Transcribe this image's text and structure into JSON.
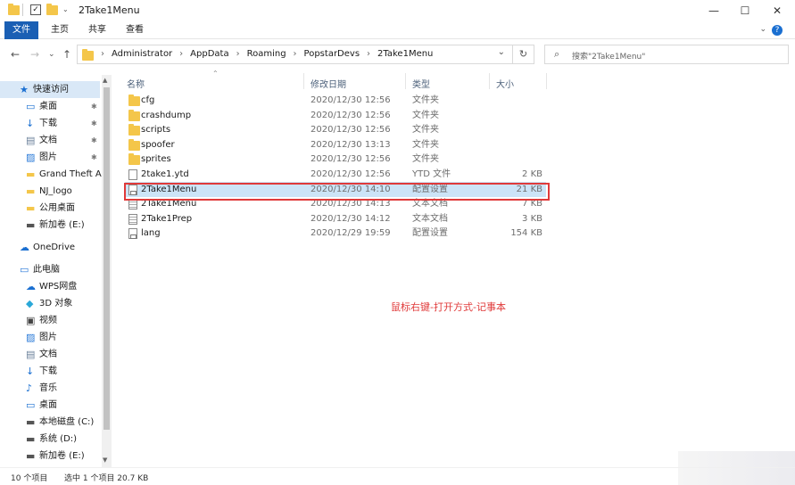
{
  "window": {
    "title": "2Take1Menu",
    "minimize": "—",
    "maximize": "☐",
    "close": "✕"
  },
  "ribbon": {
    "tabs": [
      "文件",
      "主页",
      "共享",
      "查看"
    ],
    "expand": "⌄",
    "help": "?"
  },
  "nav": {
    "back": "←",
    "forward": "→",
    "recent": "⌄",
    "up": "↑",
    "breadcrumb": [
      "Administrator",
      "AppData",
      "Roaming",
      "PopstarDevs",
      "2Take1Menu"
    ],
    "dropdown": "⌄",
    "refresh": "↻"
  },
  "search": {
    "icon": "search-icon",
    "placeholder": "搜索\"2Take1Menu\""
  },
  "sidebar": {
    "items": [
      {
        "label": "快速访问",
        "icon": "star-icon",
        "pin": false
      },
      {
        "label": "桌面",
        "icon": "desktop-icon",
        "pin": true
      },
      {
        "label": "下载",
        "icon": "download-icon",
        "pin": true
      },
      {
        "label": "文档",
        "icon": "document-icon",
        "pin": true
      },
      {
        "label": "图片",
        "icon": "picture-icon",
        "pin": true
      },
      {
        "label": "Grand Theft Au",
        "icon": "folder-icon",
        "pin": false
      },
      {
        "label": "NJ_logo",
        "icon": "folder-icon",
        "pin": false
      },
      {
        "label": "公用桌面",
        "icon": "folder-icon",
        "pin": false
      },
      {
        "label": "新加卷 (E:)",
        "icon": "drive-icon",
        "pin": false
      },
      {
        "label": "OneDrive",
        "icon": "cloud-icon",
        "pin": false
      },
      {
        "label": "此电脑",
        "icon": "computer-icon",
        "pin": false
      },
      {
        "label": "WPS网盘",
        "icon": "cloud-icon",
        "pin": false
      },
      {
        "label": "3D 对象",
        "icon": "cube-icon",
        "pin": false
      },
      {
        "label": "视频",
        "icon": "video-icon",
        "pin": false
      },
      {
        "label": "图片",
        "icon": "picture-icon",
        "pin": false
      },
      {
        "label": "文档",
        "icon": "document-icon",
        "pin": false
      },
      {
        "label": "下载",
        "icon": "download-icon",
        "pin": false
      },
      {
        "label": "音乐",
        "icon": "music-icon",
        "pin": false
      },
      {
        "label": "桌面",
        "icon": "desktop-icon",
        "pin": false
      },
      {
        "label": "本地磁盘 (C:)",
        "icon": "drive-icon",
        "pin": false
      },
      {
        "label": "系统 (D:)",
        "icon": "drive-icon",
        "pin": false
      },
      {
        "label": "新加卷 (E:)",
        "icon": "drive-icon",
        "pin": false
      }
    ],
    "pin_glyph": "📌"
  },
  "columns": {
    "name": "名称",
    "date": "修改日期",
    "type": "类型",
    "size": "大小"
  },
  "files": [
    {
      "name": "cfg",
      "date": "2020/12/30 12:56",
      "type": "文件夹",
      "size": "",
      "kind": "folder"
    },
    {
      "name": "crashdump",
      "date": "2020/12/30 12:56",
      "type": "文件夹",
      "size": "",
      "kind": "folder"
    },
    {
      "name": "scripts",
      "date": "2020/12/30 12:56",
      "type": "文件夹",
      "size": "",
      "kind": "folder"
    },
    {
      "name": "spoofer",
      "date": "2020/12/30 13:13",
      "type": "文件夹",
      "size": "",
      "kind": "folder"
    },
    {
      "name": "sprites",
      "date": "2020/12/30 12:56",
      "type": "文件夹",
      "size": "",
      "kind": "folder"
    },
    {
      "name": "2take1.ytd",
      "date": "2020/12/30 12:56",
      "type": "YTD 文件",
      "size": "2 KB",
      "kind": "file"
    },
    {
      "name": "2Take1Menu",
      "date": "2020/12/30 14:10",
      "type": "配置设置",
      "size": "21 KB",
      "kind": "config",
      "selected": true
    },
    {
      "name": "2Take1Menu",
      "date": "2020/12/30 14:13",
      "type": "文本文档",
      "size": "7 KB",
      "kind": "text"
    },
    {
      "name": "2Take1Prep",
      "date": "2020/12/30 14:12",
      "type": "文本文档",
      "size": "3 KB",
      "kind": "text"
    },
    {
      "name": "lang",
      "date": "2020/12/29 19:59",
      "type": "配置设置",
      "size": "154 KB",
      "kind": "config"
    }
  ],
  "annotation": "鼠标右键-打开方式-记事本",
  "status": {
    "count": "10 个项目",
    "selection": "选中 1 个项目  20.7 KB"
  },
  "colors": {
    "accent": "#1a5fb4",
    "selection": "#cce4f7",
    "highlight_box": "#e03a3a",
    "folder": "#f4c64a"
  }
}
